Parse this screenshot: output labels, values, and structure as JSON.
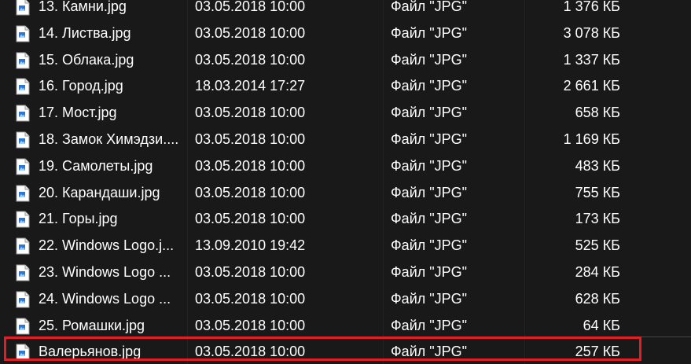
{
  "highlight_color": "#e31e24",
  "files": [
    {
      "name": "13. Камни.jpg",
      "date": "03.05.2018 10:00",
      "type": "Файл \"JPG\"",
      "size": "1 376 КБ",
      "icon": "jpg-file-icon"
    },
    {
      "name": "14. Листва.jpg",
      "date": "03.05.2018 10:00",
      "type": "Файл \"JPG\"",
      "size": "3 078 КБ",
      "icon": "jpg-file-icon"
    },
    {
      "name": "15. Облака.jpg",
      "date": "03.05.2018 10:00",
      "type": "Файл \"JPG\"",
      "size": "1 337 КБ",
      "icon": "jpg-file-icon"
    },
    {
      "name": "16. Город.jpg",
      "date": "18.03.2014 17:27",
      "type": "Файл \"JPG\"",
      "size": "2 661 КБ",
      "icon": "jpg-file-icon"
    },
    {
      "name": "17. Мост.jpg",
      "date": "03.05.2018 10:00",
      "type": "Файл \"JPG\"",
      "size": "658 КБ",
      "icon": "jpg-file-icon"
    },
    {
      "name": "18. Замок Химэдзи....",
      "date": "03.05.2018 10:00",
      "type": "Файл \"JPG\"",
      "size": "1 169 КБ",
      "icon": "jpg-file-icon"
    },
    {
      "name": "19. Самолеты.jpg",
      "date": "03.05.2018 10:00",
      "type": "Файл \"JPG\"",
      "size": "483 КБ",
      "icon": "jpg-file-icon"
    },
    {
      "name": "20. Карандаши.jpg",
      "date": "03.05.2018 10:00",
      "type": "Файл \"JPG\"",
      "size": "755 КБ",
      "icon": "jpg-file-icon"
    },
    {
      "name": "21. Горы.jpg",
      "date": "03.05.2018 10:00",
      "type": "Файл \"JPG\"",
      "size": "173 КБ",
      "icon": "jpg-file-icon"
    },
    {
      "name": "22. Windows Logo.j...",
      "date": "13.09.2010 19:42",
      "type": "Файл \"JPG\"",
      "size": "525 КБ",
      "icon": "jpg-file-icon"
    },
    {
      "name": "23. Windows Logo ...",
      "date": "03.05.2018 10:00",
      "type": "Файл \"JPG\"",
      "size": "284 КБ",
      "icon": "jpg-file-icon"
    },
    {
      "name": "24. Windows Logo ...",
      "date": "03.05.2018 10:00",
      "type": "Файл \"JPG\"",
      "size": "628 КБ",
      "icon": "jpg-file-icon"
    },
    {
      "name": "25. Ромашки.jpg",
      "date": "03.05.2018 10:00",
      "type": "Файл \"JPG\"",
      "size": "64 КБ",
      "icon": "jpg-file-icon"
    },
    {
      "name": "Валерьянов.jpg",
      "date": "03.05.2018 10:00",
      "type": "Файл \"JPG\"",
      "size": "257 КБ",
      "icon": "jpg-file-icon"
    }
  ]
}
